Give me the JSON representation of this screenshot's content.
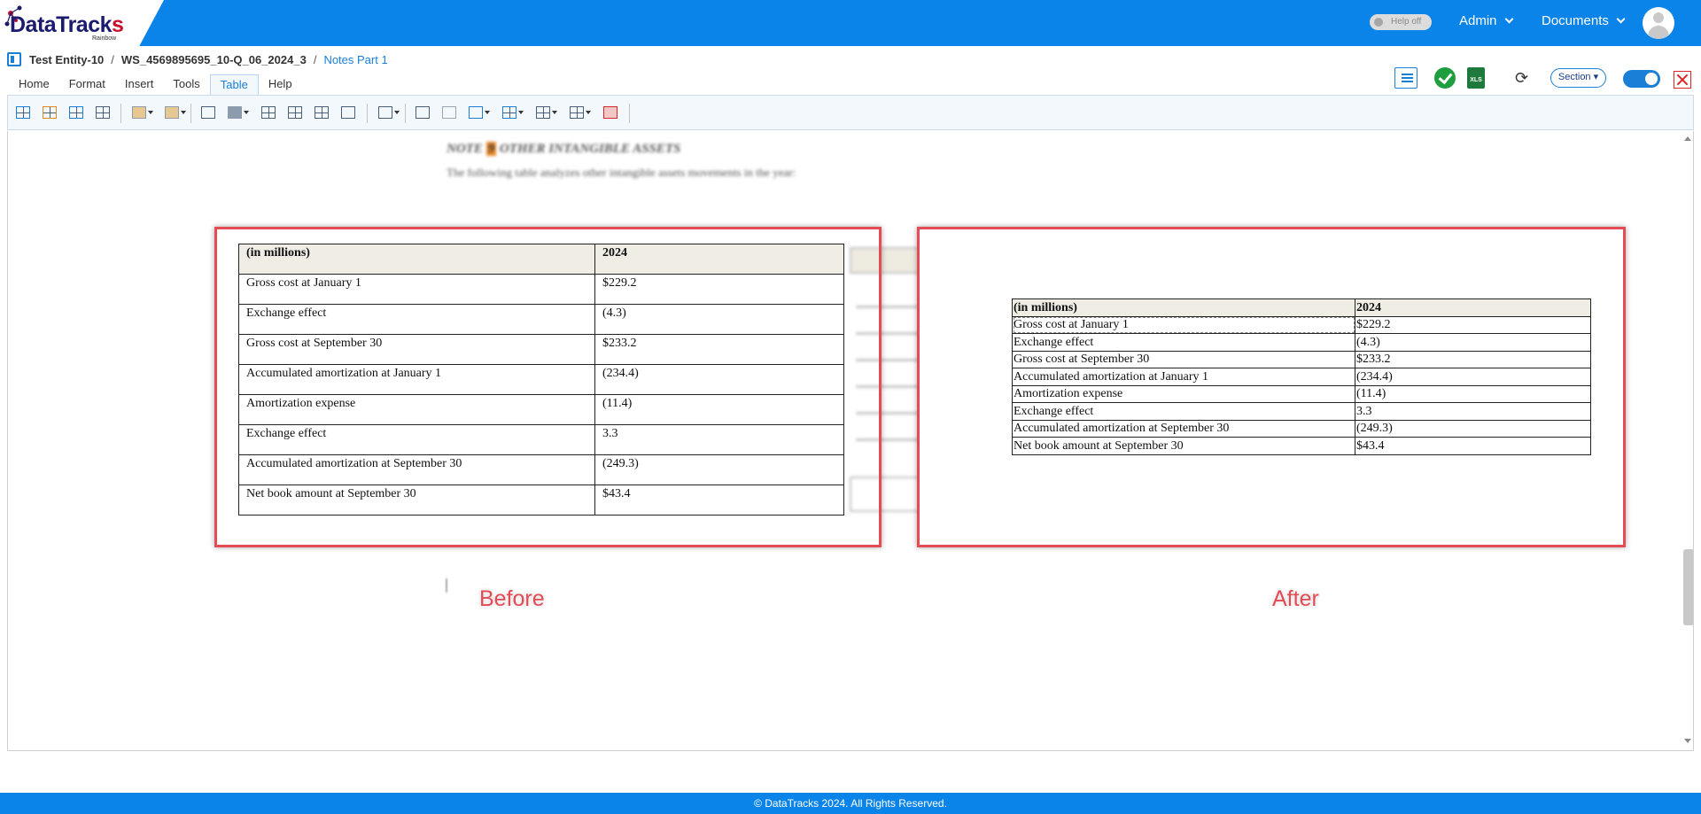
{
  "app": {
    "logo_main": "DataTrack",
    "logo_s": "s",
    "logo_sub": "Rainbow"
  },
  "topbar": {
    "help_label": "Help off",
    "admin_label": "Admin",
    "documents_label": "Documents"
  },
  "breadcrumb": {
    "entity": "Test Entity-10",
    "separator": "/",
    "workspace": "WS_4569895695_10-Q_06_2024_3",
    "section": "Notes Part 1"
  },
  "tabs": [
    {
      "label": "Home"
    },
    {
      "label": "Format"
    },
    {
      "label": "Insert"
    },
    {
      "label": "Tools"
    },
    {
      "label": "Table"
    },
    {
      "label": "Help"
    }
  ],
  "right_toolbar": {
    "xls_label": "XLS",
    "section_label": "Section"
  },
  "document": {
    "note_prefix": "NOTE",
    "note_number": "9",
    "note_title": "OTHER INTANGIBLE ASSETS",
    "note_intro": "The following table analyzes other intangible assets movements in the year:"
  },
  "table": {
    "header": [
      "(in millions)",
      "2024"
    ],
    "rows": [
      [
        "Gross cost at January 1",
        "$229.2"
      ],
      [
        "Exchange effect",
        "(4.3)"
      ],
      [
        "Gross cost at September 30",
        "$233.2"
      ],
      [
        "Accumulated amortization at January 1",
        "(234.4)"
      ],
      [
        "Amortization expense",
        "(11.4)"
      ],
      [
        "Exchange effect",
        "3.3"
      ],
      [
        "Accumulated amortization at September 30",
        "(249.3)"
      ],
      [
        "Net book amount at September 30",
        "$43.4"
      ]
    ]
  },
  "labels": {
    "before": "Before",
    "after": "After"
  },
  "footer": {
    "copyright": "© DataTracks 2024. All Rights Reserved."
  },
  "colors": {
    "topbar": "#0a84e8",
    "accent": "#1a7fd6",
    "annotation_red": "#e34b55",
    "header_cell": "#efede4"
  }
}
